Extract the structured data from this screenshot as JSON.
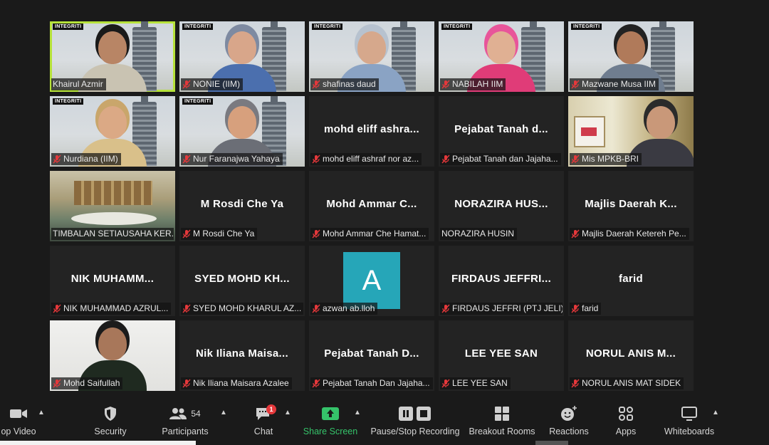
{
  "participants": [
    {
      "display": "Khairul Azmir",
      "muted": false,
      "video": "office",
      "active": true,
      "skin": "#b88565",
      "wear": "#c9c3b2",
      "hair": "#1a1a1a"
    },
    {
      "display": "NONIE (IIM)",
      "muted": true,
      "video": "office",
      "skin": "#d8a68a",
      "wear": "#4b6fae",
      "hair": "#7e8aa1"
    },
    {
      "display": "shafinas daud",
      "muted": true,
      "video": "office",
      "skin": "#d6a88c",
      "wear": "#8aa3c4",
      "hair": "#b7c2cf"
    },
    {
      "display": "NABILAH IIM",
      "muted": true,
      "video": "office",
      "skin": "#e0b093",
      "wear": "#e03c78",
      "hair": "#e8559a"
    },
    {
      "display": "Mazwane Musa IIM",
      "muted": true,
      "video": "office",
      "skin": "#b07a5a",
      "wear": "#6f7d8f",
      "hair": "#222222"
    },
    {
      "display": "Nurdiana (IIM)",
      "muted": true,
      "video": "office",
      "skin": "#dba985",
      "wear": "#d9c08a",
      "hair": "#c9a66b"
    },
    {
      "display": "Nur Faranajwa Yahaya",
      "muted": true,
      "video": "office",
      "skin": "#d7a07d",
      "wear": "#6b6e76",
      "hair": "#7a7a80"
    },
    {
      "big": "mohd eliff ashra...",
      "display": "mohd eliff ashraf nor az...",
      "muted": true
    },
    {
      "big": "Pejabat Tanah d...",
      "display": "Pejabat Tanah dan Jajaha...",
      "muted": true
    },
    {
      "display": "Mis MPKB-BRI",
      "muted": true,
      "video": "home",
      "skin": "#c99879",
      "wear": "#3a3a42",
      "hair": "#2b2b2b"
    },
    {
      "display": "TIMBALAN SETIAUSAHA KER...",
      "muted": false,
      "video": "room"
    },
    {
      "big": "M Rosdi Che Ya",
      "display": "M Rosdi Che Ya",
      "muted": true
    },
    {
      "big": "Mohd Ammar C...",
      "display": "Mohd Ammar Che Hamat...",
      "muted": true
    },
    {
      "big": "NORAZIRA HUS...",
      "display": "NORAZIRA HUSIN",
      "muted": false
    },
    {
      "big": "Majlis Daerah K...",
      "display": "Majlis Daerah Ketereh Pe...",
      "muted": true
    },
    {
      "big": "NIK MUHAMM...",
      "display": "NIK MUHAMMAD AZRUL...",
      "muted": true
    },
    {
      "big": "SYED MOHD KH...",
      "display": "SYED MOHD KHARUL AZ...",
      "muted": true
    },
    {
      "avatar": "A",
      "display": "azwan ab.lloh",
      "muted": true
    },
    {
      "big": "FIRDAUS JEFFRI...",
      "display": "FIRDAUS JEFFRI (PTJ JELI)",
      "muted": true
    },
    {
      "big": "farid",
      "display": "farid",
      "muted": true
    },
    {
      "display": "Mohd Saifullah",
      "muted": true,
      "video": "saif",
      "skin": "#a8775a",
      "wear": "#1f2a20",
      "hair": "#1b1b1b"
    },
    {
      "big": "Nik Iliana Maisa...",
      "display": "Nik Iliana Maisara Azalee",
      "muted": true
    },
    {
      "big": "Pejabat Tanah D...",
      "display": "Pejabat Tanah Dan Jajaha...",
      "muted": true
    },
    {
      "big": "LEE YEE SAN",
      "display": "LEE YEE SAN",
      "muted": true
    },
    {
      "big": "NORUL ANIS M...",
      "display": "NORUL ANIS MAT SIDEK",
      "muted": true
    }
  ],
  "logo_text": "INTEGRITI",
  "toolbar": {
    "stop_video": "op Video",
    "security": "Security",
    "participants": "Participants",
    "participants_count": "54",
    "chat": "Chat",
    "chat_badge": "1",
    "share_screen": "Share Screen",
    "recording": "Pause/Stop Recording",
    "breakout": "Breakout Rooms",
    "reactions": "Reactions",
    "apps": "Apps",
    "whiteboards": "Whiteboards"
  },
  "colors": {
    "active_border": "#b6e23a",
    "share_green": "#35c36a",
    "muted_red": "#e5383b",
    "avatar_teal": "#26a6b8"
  }
}
